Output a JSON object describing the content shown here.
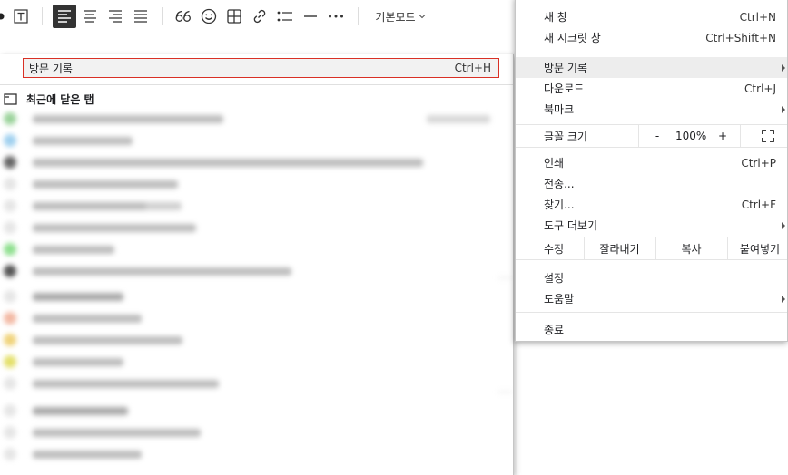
{
  "editor": {
    "toolbar": {
      "mode_label": "기본모드",
      "tools": [
        "text-bullet",
        "text-box",
        "align-left",
        "align-center",
        "align-right",
        "align-justify",
        "quote",
        "emoticon",
        "table",
        "link",
        "list",
        "divider",
        "more"
      ]
    }
  },
  "history_submenu": {
    "item_label": "방문 기록",
    "item_shortcut": "Ctrl+H",
    "recent_tabs_header": "최근에 닫은 탭"
  },
  "main_menu": {
    "new_tab": {
      "label": "새 창",
      "shortcut": "Ctrl+N"
    },
    "new_incognito": {
      "label": "새 시크릿 창",
      "shortcut": "Ctrl+Shift+N"
    },
    "history": {
      "label": "방문 기록"
    },
    "downloads": {
      "label": "다운로드",
      "shortcut": "Ctrl+J"
    },
    "bookmarks": {
      "label": "북마크"
    },
    "zoom": {
      "label": "글꼴 크기",
      "minus": "-",
      "value": "100%",
      "plus": "+"
    },
    "print": {
      "label": "인쇄",
      "shortcut": "Ctrl+P"
    },
    "cast": {
      "label": "전송..."
    },
    "find": {
      "label": "찾기...",
      "shortcut": "Ctrl+F"
    },
    "more_tools": {
      "label": "도구 더보기"
    },
    "edit": {
      "label": "수정",
      "cut": "잘라내기",
      "copy": "복사",
      "paste": "붙여넣기"
    },
    "settings": {
      "label": "설정"
    },
    "help": {
      "label": "도움말"
    },
    "exit": {
      "label": "종료"
    }
  },
  "colors": {
    "highlight_border": "#d93025",
    "hover_bg": "#ededed"
  }
}
